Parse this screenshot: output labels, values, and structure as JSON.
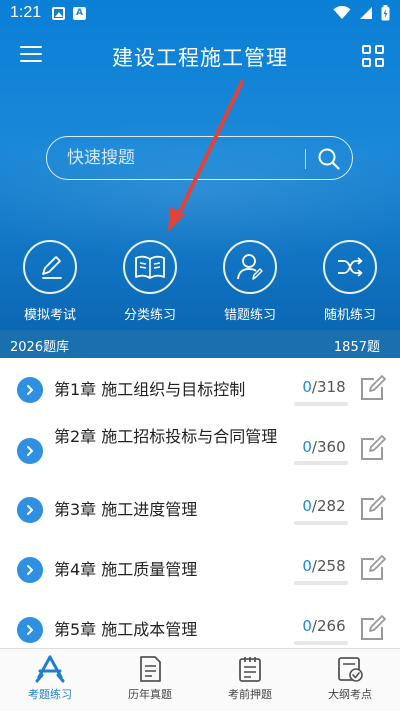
{
  "status": {
    "time": "1:21"
  },
  "app": {
    "title": "建设工程施工管理"
  },
  "search": {
    "placeholder": "快速搜题"
  },
  "quick_actions": [
    {
      "label": "模拟考试",
      "icon": "pencil-icon"
    },
    {
      "label": "分类练习",
      "icon": "book-icon"
    },
    {
      "label": "错题练习",
      "icon": "user-edit-icon"
    },
    {
      "label": "随机练习",
      "icon": "shuffle-icon"
    }
  ],
  "bank": {
    "left": "2026题库",
    "right": "1857题"
  },
  "chapters": [
    {
      "title": "第1章 施工组织与目标控制",
      "done": "0",
      "total": "/318"
    },
    {
      "title": "第2章 施工招标投标与合同管理",
      "done": "0",
      "total": "/360"
    },
    {
      "title": "第3章 施工进度管理",
      "done": "0",
      "total": "/282"
    },
    {
      "title": "第4章 施工质量管理",
      "done": "0",
      "total": "/258"
    },
    {
      "title": "第5章 施工成本管理",
      "done": "0",
      "total": "/266"
    }
  ],
  "tabs": [
    {
      "label": "考题练习",
      "active": true
    },
    {
      "label": "历年真题",
      "active": false
    },
    {
      "label": "考前押题",
      "active": false
    },
    {
      "label": "大纲考点",
      "active": false
    }
  ],
  "colors": {
    "primary": "#1a88d8",
    "accent": "#1e88e5",
    "arrow": "#e0433a"
  }
}
